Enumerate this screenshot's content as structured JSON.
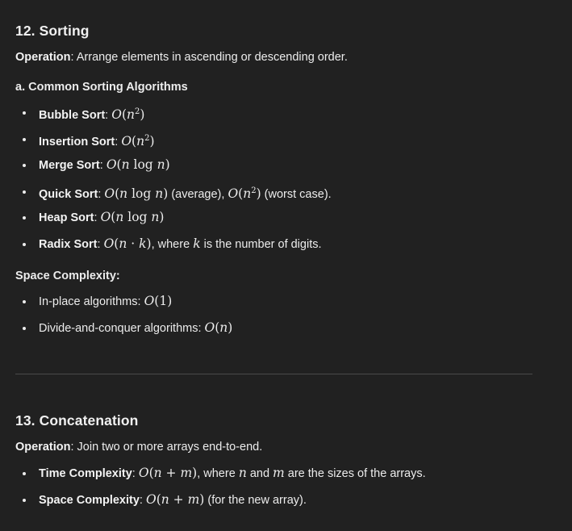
{
  "section12": {
    "title": "12. Sorting",
    "operation_label": "Operation",
    "operation_text": ": Arrange elements in ascending or descending order.",
    "subheading": "a. Common Sorting Algorithms",
    "algorithms": [
      {
        "name": "Bubble Sort",
        "sep": ": ",
        "complexity": "O(n²)"
      },
      {
        "name": "Insertion Sort",
        "sep": ": ",
        "complexity": "O(n²)"
      },
      {
        "name": "Merge Sort",
        "sep": ": ",
        "complexity": "O(n log n)"
      },
      {
        "name": "Quick Sort",
        "sep": ": ",
        "complexity": "O(n log n)",
        "mid": " (average), ",
        "complexity2": "O(n²)",
        "tail": " (worst case)."
      },
      {
        "name": "Heap Sort",
        "sep": ": ",
        "complexity": "O(n log n)"
      },
      {
        "name": "Radix Sort",
        "sep": ": ",
        "complexity": "O(n · k)",
        "mid": ", where ",
        "var": "k",
        "tail": " is the number of digits."
      }
    ],
    "space_heading": "Space Complexity:",
    "space_items": [
      {
        "text": "In-place algorithms: ",
        "complexity": "O(1)"
      },
      {
        "text": "Divide-and-conquer algorithms: ",
        "complexity": "O(n)"
      }
    ]
  },
  "section13": {
    "title": "13. Concatenation",
    "operation_label": "Operation",
    "operation_text": ": Join two or more arrays end-to-end.",
    "items": [
      {
        "label": "Time Complexity",
        "sep": ": ",
        "complexity": "O(n + m)",
        "mid": ", where ",
        "var1": "n",
        "and": " and ",
        "var2": "m",
        "tail": " are the sizes of the arrays."
      },
      {
        "label": "Space Complexity",
        "sep": ": ",
        "complexity": "O(n + m)",
        "tail": " (for the new array)."
      }
    ]
  }
}
